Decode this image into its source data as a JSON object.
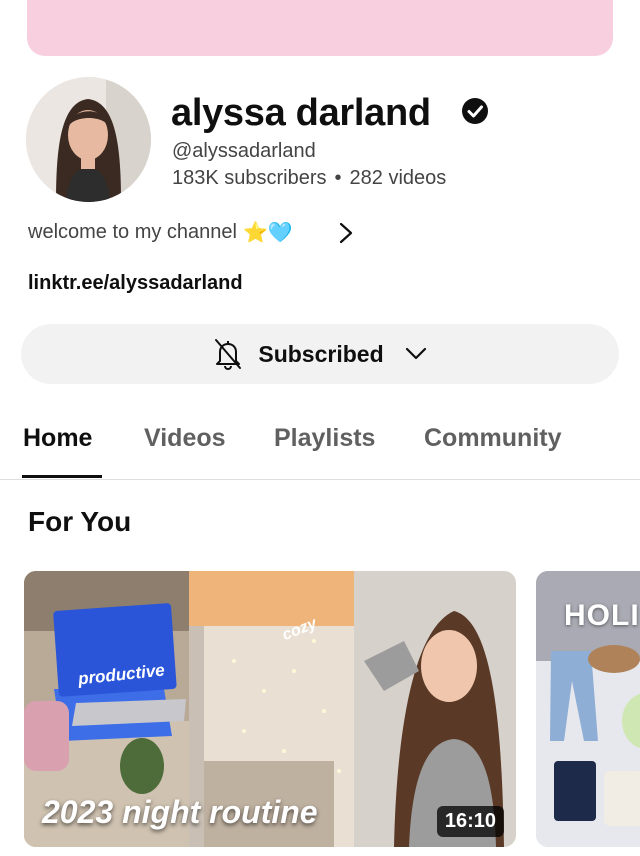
{
  "channel": {
    "name": "alyssa darland",
    "handle": "@alyssadarland",
    "subscribers": "183K subscribers",
    "videos": "282 videos",
    "description": "welcome to my channel",
    "description_emoji": "⭐🩵",
    "link": "linktr.ee/alyssadarland",
    "banner_color": "#f7cfdf"
  },
  "subscribe_button": {
    "label": "Subscribed",
    "icon": "bell-off-icon"
  },
  "tabs": [
    {
      "label": "Home",
      "active": true
    },
    {
      "label": "Videos",
      "active": false
    },
    {
      "label": "Playlists",
      "active": false
    },
    {
      "label": "Community",
      "active": false
    }
  ],
  "section": {
    "title": "For You"
  },
  "videos": [
    {
      "title": "2023 night routine",
      "duration": "16:10",
      "thumb_tags": [
        "productive",
        "cozy"
      ]
    },
    {
      "thumb_text": "HOLI"
    }
  ]
}
